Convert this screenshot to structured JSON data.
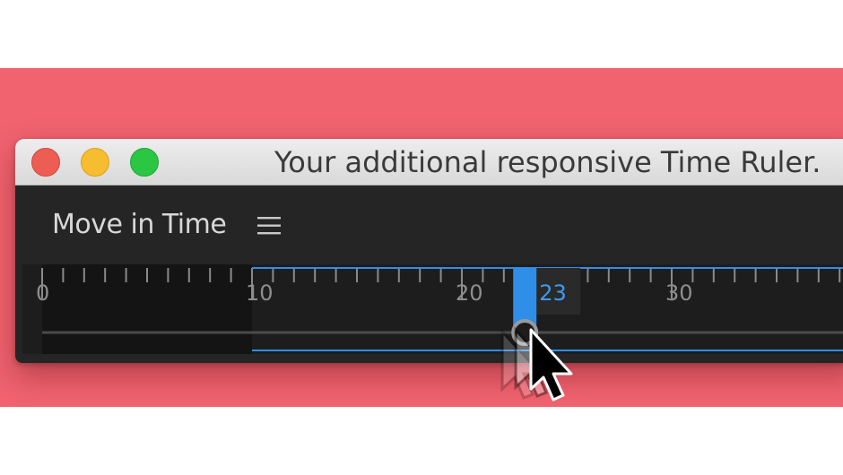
{
  "window": {
    "title": "Your additional responsive Time Ruler."
  },
  "panel": {
    "title": "Move in Time",
    "menu_icon": "hamburger-menu-icon"
  },
  "ruler": {
    "tick_labels": [
      "0",
      "10",
      "20",
      "30"
    ],
    "current_value": "23",
    "current": 23,
    "range_start": 10,
    "visible_max": 40,
    "colors": {
      "accent": "#2f8ee8",
      "background": "#1d1d1d",
      "inactive_region": "#141414",
      "ticks": "#8a8a8a"
    }
  },
  "colors": {
    "backdrop": "#f0636f",
    "close": "#ee5d54",
    "minimize": "#f5bd2f",
    "zoom": "#2bc743"
  }
}
